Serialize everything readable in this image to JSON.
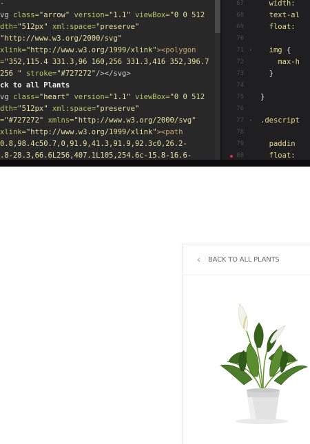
{
  "editor": {
    "left_pane": {
      "lines": [
        {
          "parts": [
            {
              "t": "-",
              "c": "tag"
            }
          ]
        },
        {
          "parts": [
            {
              "t": "vg ",
              "c": "tag"
            },
            {
              "t": "class=",
              "c": "attr"
            },
            {
              "t": "\"arrow\" ",
              "c": "str"
            },
            {
              "t": "version=",
              "c": "attr"
            },
            {
              "t": "\"1.1\" ",
              "c": "str"
            },
            {
              "t": "viewBox=",
              "c": "attr"
            },
            {
              "t": "\"0 0 512",
              "c": "str"
            }
          ]
        },
        {
          "parts": [
            {
              "t": "dth=",
              "c": "attr"
            },
            {
              "t": "\"512px\" ",
              "c": "str"
            },
            {
              "t": "xml:space=",
              "c": "attr"
            },
            {
              "t": "\"preserve\"",
              "c": "str"
            }
          ]
        },
        {
          "parts": [
            {
              "t": "\"http://www.w3.org/2000/svg\"",
              "c": "str"
            }
          ]
        },
        {
          "parts": [
            {
              "t": "xlink=",
              "c": "attr"
            },
            {
              "t": "\"http://www.w3.org/1999/xlink\"",
              "c": "str"
            },
            {
              "t": "><polygon",
              "c": "path"
            }
          ]
        },
        {
          "parts": [
            {
              "t": "=",
              "c": "attr"
            },
            {
              "t": "\"352,115.4 331.3,96 160,256 331.3,416 352,396.7",
              "c": "str"
            }
          ]
        },
        {
          "parts": [
            {
              "t": "256 \" ",
              "c": "str"
            },
            {
              "t": "stroke=",
              "c": "attr"
            },
            {
              "t": "\"#727272\"",
              "c": "str"
            },
            {
              "t": "/></svg>",
              "c": "tag"
            }
          ]
        },
        {
          "parts": [
            {
              "t": "ck to all Plants",
              "c": "txt"
            }
          ]
        },
        {
          "parts": [
            {
              "t": "vg ",
              "c": "tag"
            },
            {
              "t": "class=",
              "c": "attr"
            },
            {
              "t": "\"heart\" ",
              "c": "str"
            },
            {
              "t": "version=",
              "c": "attr"
            },
            {
              "t": "\"1.1\" ",
              "c": "str"
            },
            {
              "t": "viewBox=",
              "c": "attr"
            },
            {
              "t": "\"0 0 512",
              "c": "str"
            }
          ]
        },
        {
          "parts": [
            {
              "t": "dth=",
              "c": "attr"
            },
            {
              "t": "\"512px\" ",
              "c": "str"
            },
            {
              "t": "xml:space=",
              "c": "attr"
            },
            {
              "t": "\"preserve\"",
              "c": "str"
            }
          ]
        },
        {
          "parts": [
            {
              "t": "=",
              "c": "attr"
            },
            {
              "t": "\"#727272\" ",
              "c": "str"
            },
            {
              "t": "xmlns=",
              "c": "attr"
            },
            {
              "t": "\"http://www.w3.org/2000/svg\"",
              "c": "str"
            }
          ]
        },
        {
          "parts": [
            {
              "t": "xlink=",
              "c": "attr"
            },
            {
              "t": "\"http://www.w3.org/1999/xlink\"",
              "c": "str"
            },
            {
              "t": "><path",
              "c": "path"
            }
          ]
        },
        {
          "parts": [
            {
              "t": "0.8,98.4c50.7,0,91.9,41.3,91.9,92.3c0,26.2-",
              "c": "str"
            }
          ]
        },
        {
          "parts": [
            {
              "t": ".8-28.3,66.6L256,407.1L105,254.6c-15.8-16.6-",
              "c": "str"
            }
          ]
        }
      ]
    },
    "right_pane": {
      "line_numbers": [
        "67",
        "68",
        "69",
        "70",
        "71",
        "72",
        "73",
        "74",
        "75",
        "76",
        "77",
        "78",
        "79",
        "80"
      ],
      "fold_lines": [
        "71",
        "77"
      ],
      "error_line": "80",
      "lines": [
        {
          "indent": "  ",
          "parts": [
            {
              "t": "width:",
              "c": "prop"
            }
          ]
        },
        {
          "indent": "  ",
          "parts": [
            {
              "t": "text-al",
              "c": "prop"
            }
          ]
        },
        {
          "indent": "  ",
          "parts": [
            {
              "t": "float:",
              "c": "prop"
            }
          ]
        },
        {
          "indent": "",
          "parts": []
        },
        {
          "indent": "  ",
          "parts": [
            {
              "t": "img ",
              "c": "sel"
            },
            {
              "t": "{",
              "c": "brace"
            }
          ]
        },
        {
          "indent": "    ",
          "parts": [
            {
              "t": "max-h",
              "c": "prop"
            }
          ]
        },
        {
          "indent": "  ",
          "parts": [
            {
              "t": "}",
              "c": "brace"
            }
          ]
        },
        {
          "indent": "",
          "parts": []
        },
        {
          "indent": "",
          "parts": [
            {
              "t": "}",
              "c": "brace"
            }
          ]
        },
        {
          "indent": "",
          "parts": []
        },
        {
          "indent": "",
          "parts": [
            {
              "t": ".descript",
              "c": "sel"
            }
          ]
        },
        {
          "indent": "",
          "parts": []
        },
        {
          "indent": "  ",
          "parts": [
            {
              "t": "paddin",
              "c": "prop"
            }
          ]
        },
        {
          "indent": "  ",
          "parts": [
            {
              "t": "float:",
              "c": "prop"
            }
          ]
        }
      ]
    }
  },
  "card": {
    "back_label": "BACK TO ALL PLANTS",
    "back_icon": "chevron-left-icon",
    "image_subject": "potted peace lily plant"
  },
  "colors": {
    "editor_bg": "#282828",
    "attr": "#b9c46a",
    "string": "#e6e0a0",
    "error_dot": "#e03030",
    "chevron": "#727272"
  }
}
